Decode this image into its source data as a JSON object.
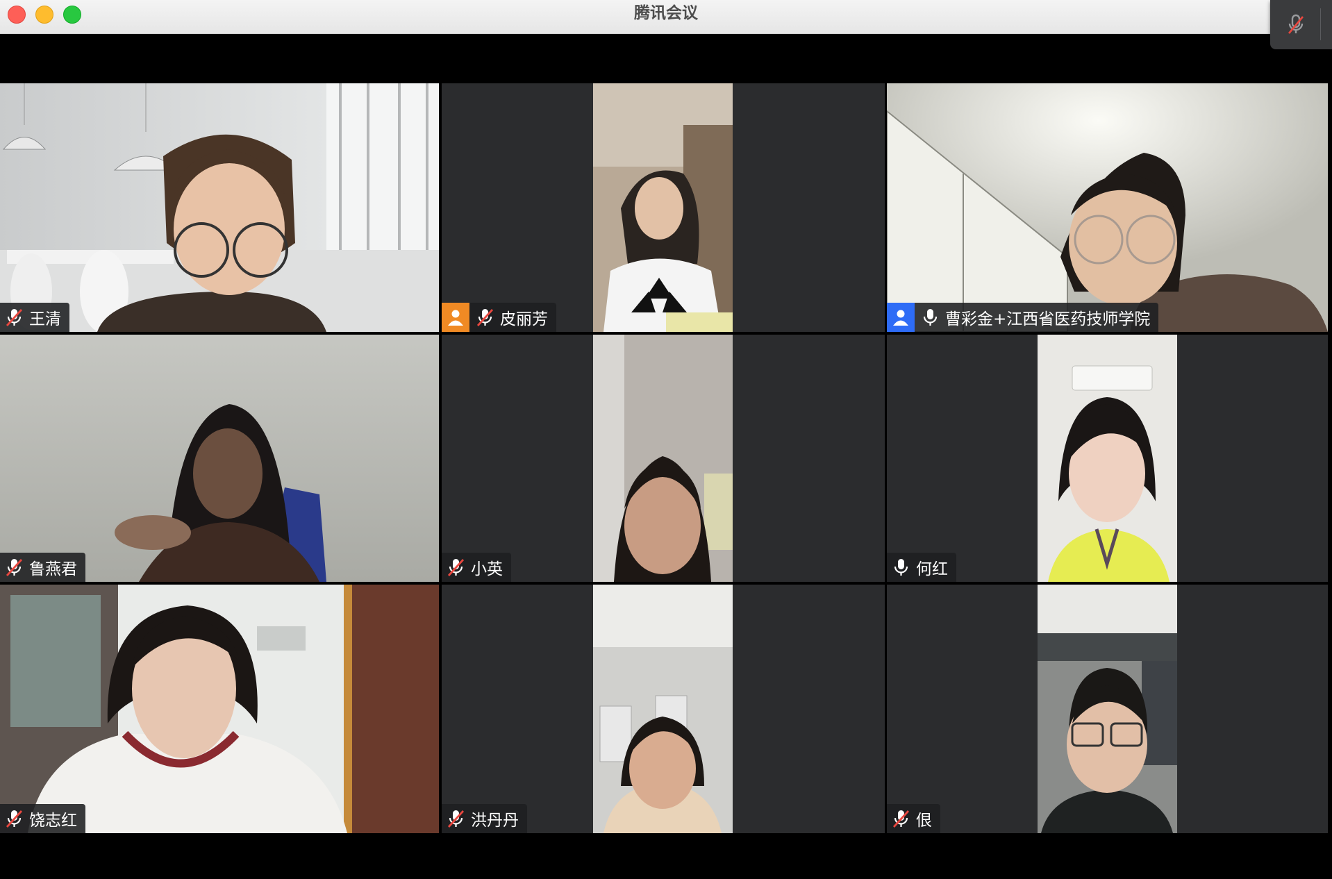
{
  "window": {
    "title": "腾讯会议"
  },
  "colors": {
    "muted_icon": "#e8473f",
    "orange_avatar": "#f08a24",
    "blue_avatar": "#2e6cf6"
  },
  "participants": [
    {
      "name": "王清",
      "mic": "muted",
      "avatar": null
    },
    {
      "name": "皮丽芳",
      "mic": "muted",
      "avatar": "person-icon-orange"
    },
    {
      "name": "曹彩金+江西省医药技师学院",
      "mic": "on",
      "avatar": "person-icon-blue"
    },
    {
      "name": "鲁燕君",
      "mic": "muted",
      "avatar": null
    },
    {
      "name": "小英",
      "mic": "muted",
      "avatar": null
    },
    {
      "name": "何红",
      "mic": "on",
      "avatar": null
    },
    {
      "name": "饶志红",
      "mic": "muted",
      "avatar": null
    },
    {
      "name": "洪丹丹",
      "mic": "muted",
      "avatar": null
    },
    {
      "name": "佷",
      "mic": "muted",
      "avatar": null
    }
  ]
}
